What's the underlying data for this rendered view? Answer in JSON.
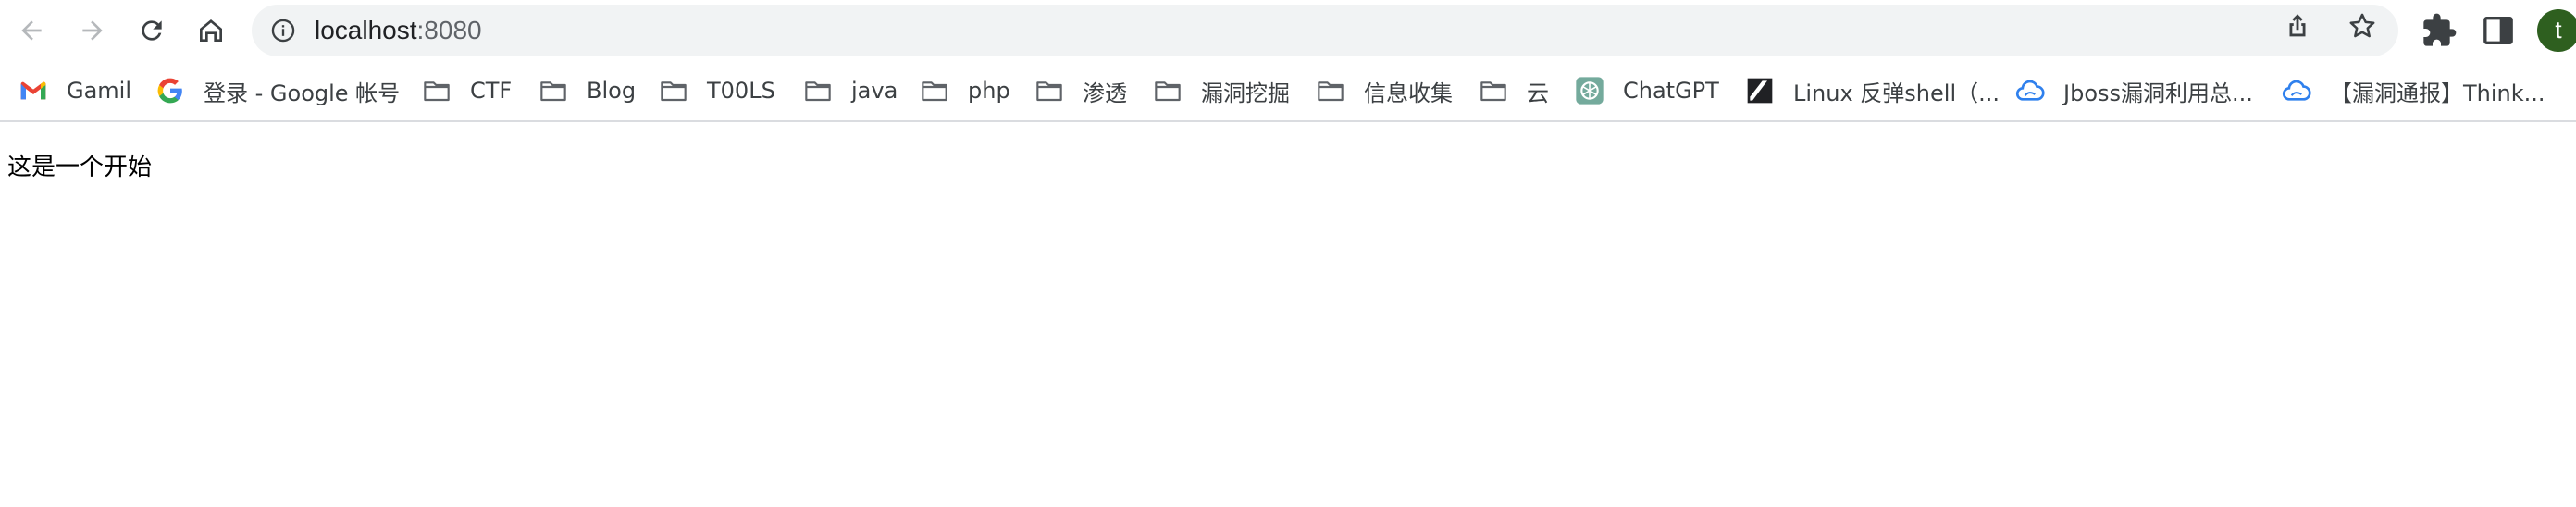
{
  "toolbar": {
    "url_host": "localhost",
    "url_port": ":8080",
    "avatar_letter": "t"
  },
  "bookmarks": [
    {
      "label": "Gamil",
      "icon": "gmail-icon"
    },
    {
      "label": "登录 - Google 帐号",
      "icon": "google-icon"
    },
    {
      "label": "CTF",
      "icon": "folder-icon"
    },
    {
      "label": "Blog",
      "icon": "folder-icon"
    },
    {
      "label": "T00LS",
      "icon": "folder-icon"
    },
    {
      "label": "java",
      "icon": "folder-icon"
    },
    {
      "label": "php",
      "icon": "folder-icon"
    },
    {
      "label": "渗透",
      "icon": "folder-icon"
    },
    {
      "label": "漏洞挖掘",
      "icon": "folder-icon"
    },
    {
      "label": "信息收集",
      "icon": "folder-icon"
    },
    {
      "label": "云",
      "icon": "folder-icon"
    },
    {
      "label": "ChatGPT",
      "icon": "chatgpt-icon"
    },
    {
      "label": "Linux 反弹shell（...",
      "icon": "zhihu-slash-icon"
    },
    {
      "label": "Jboss漏洞利用总...",
      "icon": "cloud-icon"
    },
    {
      "label": "【漏洞通报】Think...",
      "icon": "cloud-icon"
    }
  ],
  "page": {
    "text": "这是一个开始"
  }
}
